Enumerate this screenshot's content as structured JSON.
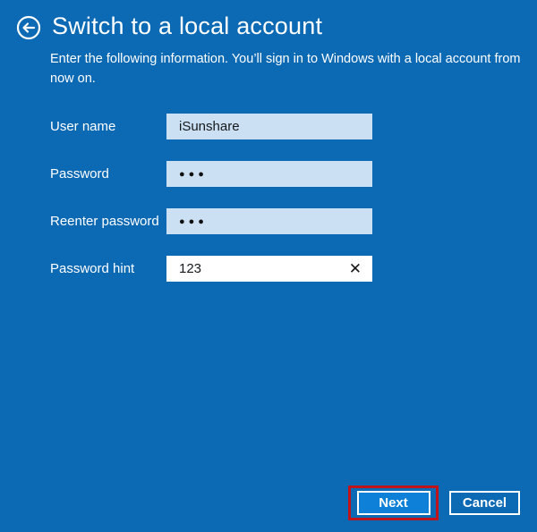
{
  "header": {
    "title": "Switch to a local account",
    "description_line1": "Enter the following information. You’ll sign in to Windows with a local account from",
    "description_line2": "now on.",
    "back_icon": "back-arrow-circle-icon"
  },
  "form": {
    "fields": [
      {
        "label": "User name",
        "value": "iSunshare",
        "masked": false,
        "focused": false
      },
      {
        "label": "Password",
        "value": "●●●",
        "masked": true,
        "focused": false
      },
      {
        "label": "Reenter password",
        "value": "●●●",
        "masked": true,
        "focused": false
      },
      {
        "label": "Password hint",
        "value": "123",
        "masked": false,
        "focused": true
      }
    ],
    "clear_icon_glyph": "✕"
  },
  "footer": {
    "next_label": "Next",
    "cancel_label": "Cancel"
  },
  "annotation": {
    "description": "red highlight box around Next button",
    "color": "#bf141c"
  },
  "colors": {
    "background": "#0c69b4",
    "input_background": "#cbe0f2",
    "focused_input_background": "#ffffff",
    "next_button": "#0f80d7",
    "text_on_blue": "#ffffff",
    "input_text": "#16191c"
  }
}
